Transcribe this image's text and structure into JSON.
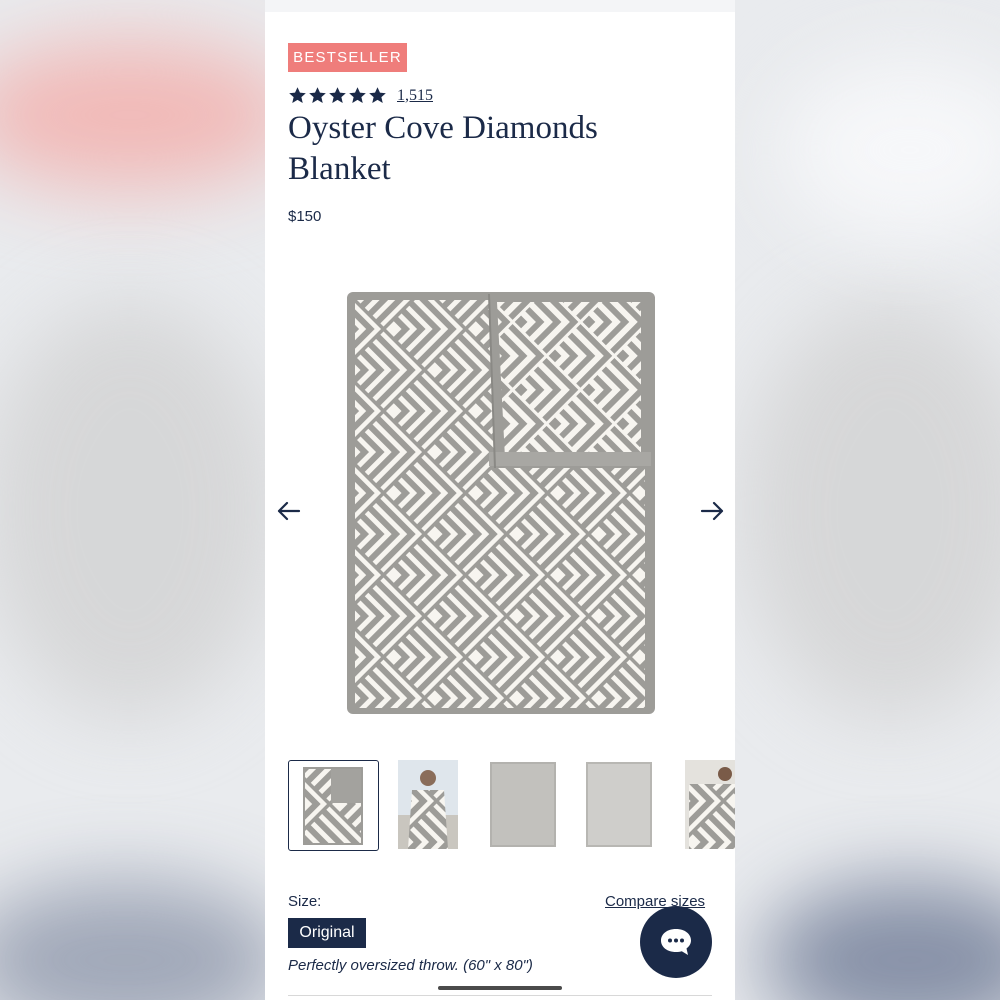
{
  "product": {
    "badge": "BESTSELLER",
    "rating": 5,
    "review_count": "1,515",
    "title": "Oyster Cove Diamonds Blanket",
    "price": "$150"
  },
  "gallery": {
    "thumbnail_count": 5,
    "selected_index": 0
  },
  "size": {
    "label": "Size:",
    "compare_link": "Compare sizes",
    "selected": "Original",
    "description": "Perfectly oversized throw. (60\" x 80\")"
  },
  "colors": {
    "navy": "#1b2a48",
    "badge": "#ef7d7b",
    "blanket_gray": "#9d9c98",
    "blanket_cream": "#f7f5f0"
  },
  "icons": {
    "prev": "arrow-left-icon",
    "next": "arrow-right-icon",
    "chat": "chat-bubble-icon",
    "star": "star-icon"
  }
}
